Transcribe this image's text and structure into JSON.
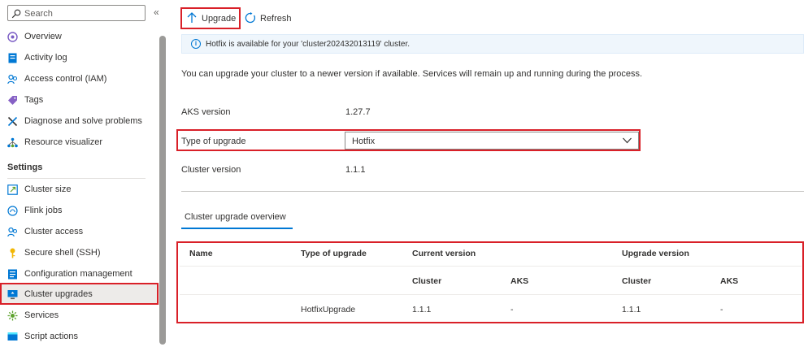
{
  "sidebar": {
    "search_placeholder": "Search",
    "collapse_label": "«",
    "items": [
      {
        "label": "Overview"
      },
      {
        "label": "Activity log"
      },
      {
        "label": "Access control (IAM)"
      },
      {
        "label": "Tags"
      },
      {
        "label": "Diagnose and solve problems"
      },
      {
        "label": "Resource visualizer"
      }
    ],
    "settings_header": "Settings",
    "settings_items": [
      {
        "label": "Cluster size"
      },
      {
        "label": "Flink jobs"
      },
      {
        "label": "Cluster access"
      },
      {
        "label": "Secure shell (SSH)"
      },
      {
        "label": "Configuration management"
      },
      {
        "label": "Cluster upgrades",
        "selected": true
      },
      {
        "label": "Services"
      },
      {
        "label": "Script actions"
      }
    ]
  },
  "toolbar": {
    "upgrade_label": "Upgrade",
    "refresh_label": "Refresh"
  },
  "banner": {
    "text": "Hotfix is available for your 'cluster202432013119' cluster."
  },
  "description": "You can upgrade your cluster to a newer version if available. Services will remain up and running during the process.",
  "properties": {
    "aks_version_label": "AKS version",
    "aks_version_value": "1.27.7",
    "upgrade_type_label": "Type of upgrade",
    "upgrade_type_value": "Hotfix",
    "cluster_version_label": "Cluster version",
    "cluster_version_value": "1.1.1"
  },
  "overview_tab": "Cluster upgrade overview",
  "table": {
    "headers": {
      "name": "Name",
      "type": "Type of upgrade",
      "current": "Current version",
      "upgrade": "Upgrade version"
    },
    "subheaders": {
      "current_cluster": "Cluster",
      "current_aks": "AKS",
      "upgrade_cluster": "Cluster",
      "upgrade_aks": "AKS"
    },
    "rows": [
      {
        "name": "",
        "type": "HotfixUpgrade",
        "current_cluster": "1.1.1",
        "current_aks": "-",
        "upgrade_cluster": "1.1.1",
        "upgrade_aks": "-"
      }
    ]
  },
  "colors": {
    "accent": "#0078d4",
    "highlight": "#d92028",
    "selected_bg": "#edebe9"
  }
}
